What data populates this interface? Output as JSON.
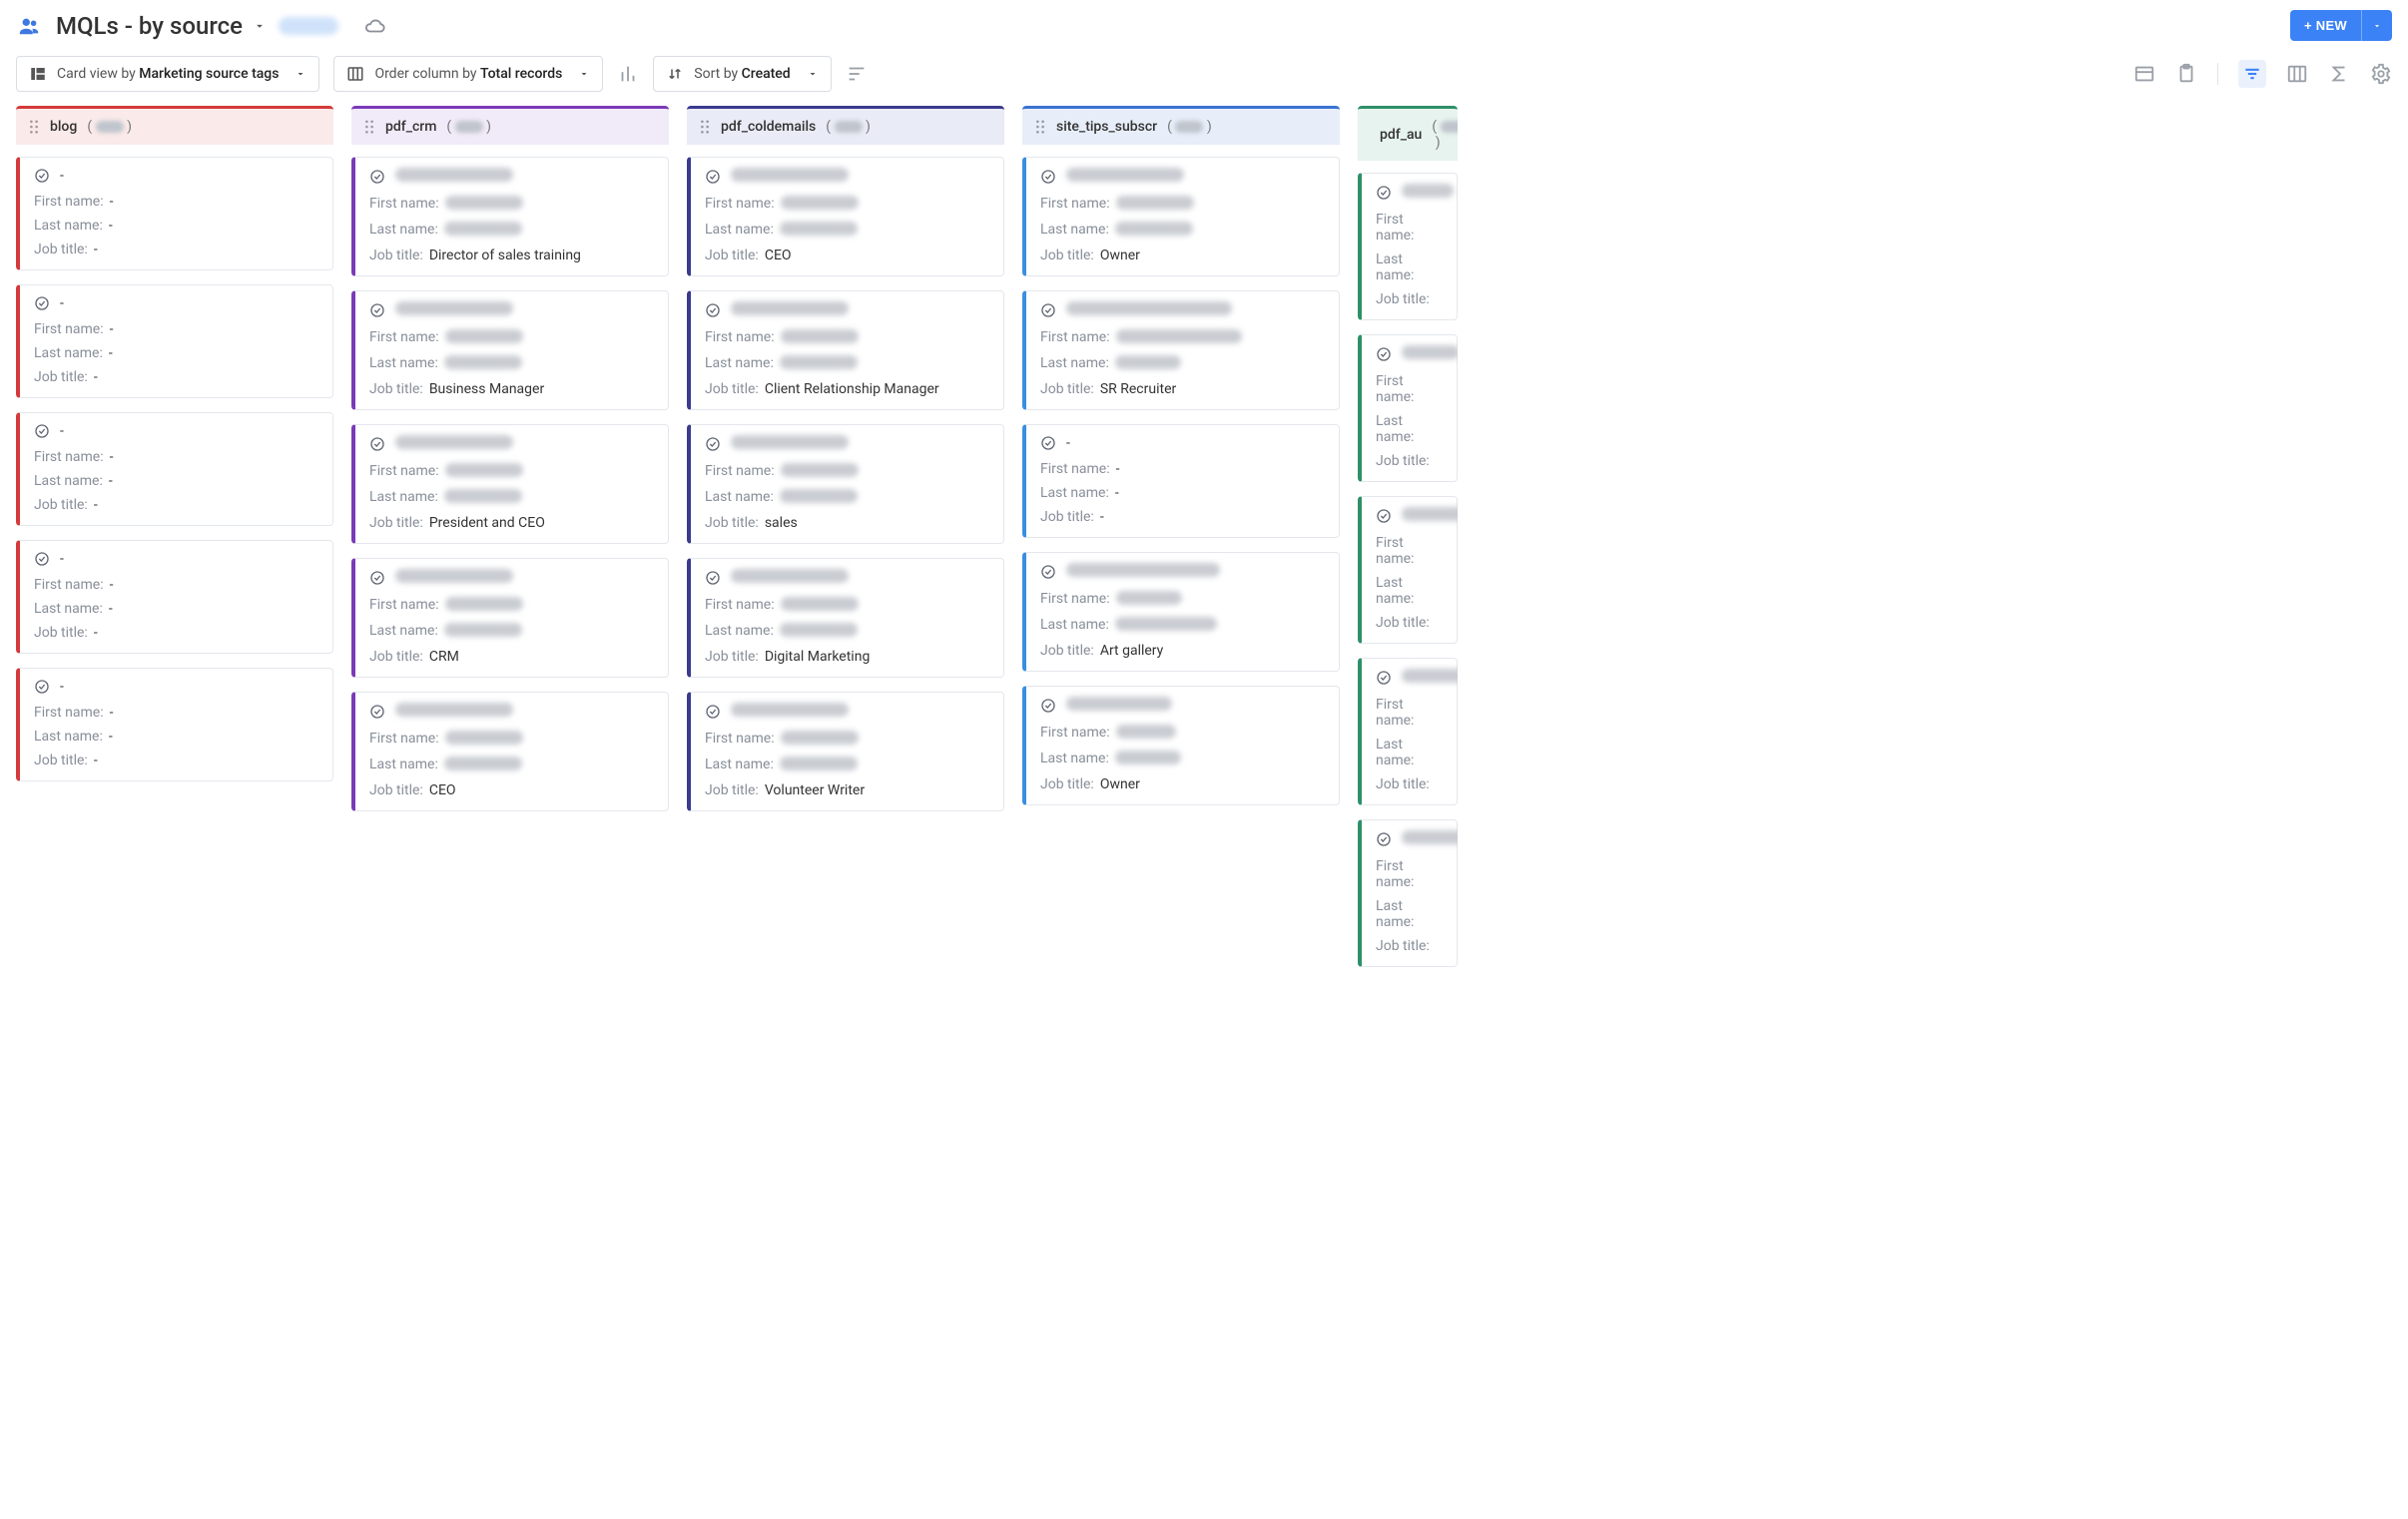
{
  "header": {
    "title": "MQLs - by source",
    "new_button": "+ NEW"
  },
  "toolbar": {
    "card_view": {
      "prefix": "Card view by ",
      "value": "Marketing source tags"
    },
    "order": {
      "prefix": "Order column by ",
      "value": "Total records"
    },
    "sort": {
      "prefix": "Sort by ",
      "value": "Created"
    }
  },
  "field_labels": {
    "first_name": "First name:",
    "last_name": "Last name:",
    "job_title": "Job title:"
  },
  "columns": [
    {
      "id": "blog",
      "css": "col-blog",
      "name": "blog",
      "cards": [
        {
          "title": "-",
          "title_blur": false,
          "first_name": "-",
          "fn_blur": false,
          "last_name": "-",
          "ln_blur": false,
          "job_title": "-"
        },
        {
          "title": "-",
          "title_blur": false,
          "first_name": "-",
          "fn_blur": false,
          "last_name": "-",
          "ln_blur": false,
          "job_title": "-"
        },
        {
          "title": "-",
          "title_blur": false,
          "first_name": "-",
          "fn_blur": false,
          "last_name": "-",
          "ln_blur": false,
          "job_title": "-"
        },
        {
          "title": "-",
          "title_blur": false,
          "first_name": "-",
          "fn_blur": false,
          "last_name": "-",
          "ln_blur": false,
          "job_title": "-"
        },
        {
          "title": "-",
          "title_blur": false,
          "first_name": "-",
          "fn_blur": false,
          "last_name": "-",
          "ln_blur": false,
          "job_title": "-"
        }
      ]
    },
    {
      "id": "pdf_crm",
      "css": "col-pdfcrm",
      "name": "pdf_crm",
      "cards": [
        {
          "title": "redacted name",
          "title_blur": true,
          "first_name": "redacted",
          "fn_blur": true,
          "last_name": "redacted",
          "ln_blur": true,
          "job_title": "Director of sales training"
        },
        {
          "title": "redacted name",
          "title_blur": true,
          "first_name": "redacted",
          "fn_blur": true,
          "last_name": "redacted",
          "ln_blur": true,
          "job_title": "Business Manager"
        },
        {
          "title": "redacted name",
          "title_blur": true,
          "first_name": "redacted",
          "fn_blur": true,
          "last_name": "redacted",
          "ln_blur": true,
          "job_title": "President and CEO"
        },
        {
          "title": "redacted name",
          "title_blur": true,
          "first_name": "redacted",
          "fn_blur": true,
          "last_name": "redacted",
          "ln_blur": true,
          "job_title": "CRM"
        },
        {
          "title": "redacted name",
          "title_blur": true,
          "first_name": "redacted",
          "fn_blur": true,
          "last_name": "redacted",
          "ln_blur": true,
          "job_title": "CEO"
        }
      ]
    },
    {
      "id": "pdf_coldemails",
      "css": "col-cold",
      "name": "pdf_coldemails",
      "cards": [
        {
          "title": "redacted name",
          "title_blur": true,
          "first_name": "redacted",
          "fn_blur": true,
          "last_name": "redacted",
          "ln_blur": true,
          "job_title": "CEO"
        },
        {
          "title": "redacted name",
          "title_blur": true,
          "first_name": "redacted",
          "fn_blur": true,
          "last_name": "redacted",
          "ln_blur": true,
          "job_title": "Client Relationship Manager"
        },
        {
          "title": "redacted name",
          "title_blur": true,
          "first_name": "redacted",
          "fn_blur": true,
          "last_name": "redacted",
          "ln_blur": true,
          "job_title": "sales"
        },
        {
          "title": "redacted name",
          "title_blur": true,
          "first_name": "redacted",
          "fn_blur": true,
          "last_name": "redacted",
          "ln_blur": true,
          "job_title": "Digital Marketing"
        },
        {
          "title": "redacted name",
          "title_blur": true,
          "first_name": "redacted",
          "fn_blur": true,
          "last_name": "redacted",
          "ln_blur": true,
          "job_title": "Volunteer Writer"
        }
      ]
    },
    {
      "id": "site_tips_subscr",
      "css": "col-tips",
      "name": "site_tips_subscr",
      "cards": [
        {
          "title": "redacted name",
          "title_blur": true,
          "first_name": "redacted",
          "fn_blur": true,
          "last_name": "redacted",
          "ln_blur": true,
          "job_title": "Owner"
        },
        {
          "title": "redacted name redacte",
          "title_blur": true,
          "first_name": "redacted redacte",
          "fn_blur": true,
          "last_name": "redact",
          "ln_blur": true,
          "job_title": "SR Recruiter"
        },
        {
          "title": "-",
          "title_blur": false,
          "first_name": "-",
          "fn_blur": false,
          "last_name": "-",
          "ln_blur": false,
          "job_title": "-"
        },
        {
          "title": "redacted redactedna",
          "title_blur": true,
          "first_name": "redact",
          "fn_blur": true,
          "last_name": "redactedname",
          "ln_blur": true,
          "job_title": "Art gallery"
        },
        {
          "title": "redacted na",
          "title_blur": true,
          "first_name": "redac",
          "fn_blur": true,
          "last_name": "redact",
          "ln_blur": true,
          "job_title": "Owner"
        }
      ]
    },
    {
      "id": "pdf_au",
      "css": "col-pdfa",
      "name": "pdf_au",
      "cards": [
        {
          "title": "re",
          "title_blur": true,
          "first_name": "",
          "fn_blur": false,
          "last_name": "",
          "ln_blur": false,
          "job_title": ""
        },
        {
          "title": "red",
          "title_blur": true,
          "first_name": "",
          "fn_blur": false,
          "last_name": "",
          "ln_blur": false,
          "job_title": ""
        },
        {
          "title": "reda",
          "title_blur": true,
          "first_name": "",
          "fn_blur": false,
          "last_name": "",
          "ln_blur": false,
          "job_title": ""
        },
        {
          "title": "reda",
          "title_blur": true,
          "first_name": "",
          "fn_blur": false,
          "last_name": "",
          "ln_blur": false,
          "job_title": ""
        },
        {
          "title": "reda",
          "title_blur": true,
          "first_name": "",
          "fn_blur": false,
          "last_name": "",
          "ln_blur": false,
          "job_title": ""
        }
      ]
    }
  ]
}
